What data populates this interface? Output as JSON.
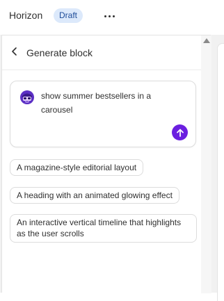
{
  "header": {
    "app_name": "Horizon",
    "status_badge": "Draft",
    "more_icon": "more-horizontal-icon"
  },
  "panel": {
    "title": "Generate block",
    "back_icon": "chevron-left-icon"
  },
  "prompt": {
    "avatar_icon": "ai-avatar-icon",
    "text": "show summer bestsellers in a carousel",
    "send_icon": "arrow-up-icon"
  },
  "suggestions": [
    {
      "label": "A magazine-style editorial layout"
    },
    {
      "label": "A heading with an animated glowing effect"
    },
    {
      "label": "An interactive vertical timeline that highlights as the user scrolls"
    }
  ],
  "colors": {
    "accent": "#6b1fe0",
    "badge_bg": "#dce9fb",
    "badge_text": "#1f4d99"
  }
}
